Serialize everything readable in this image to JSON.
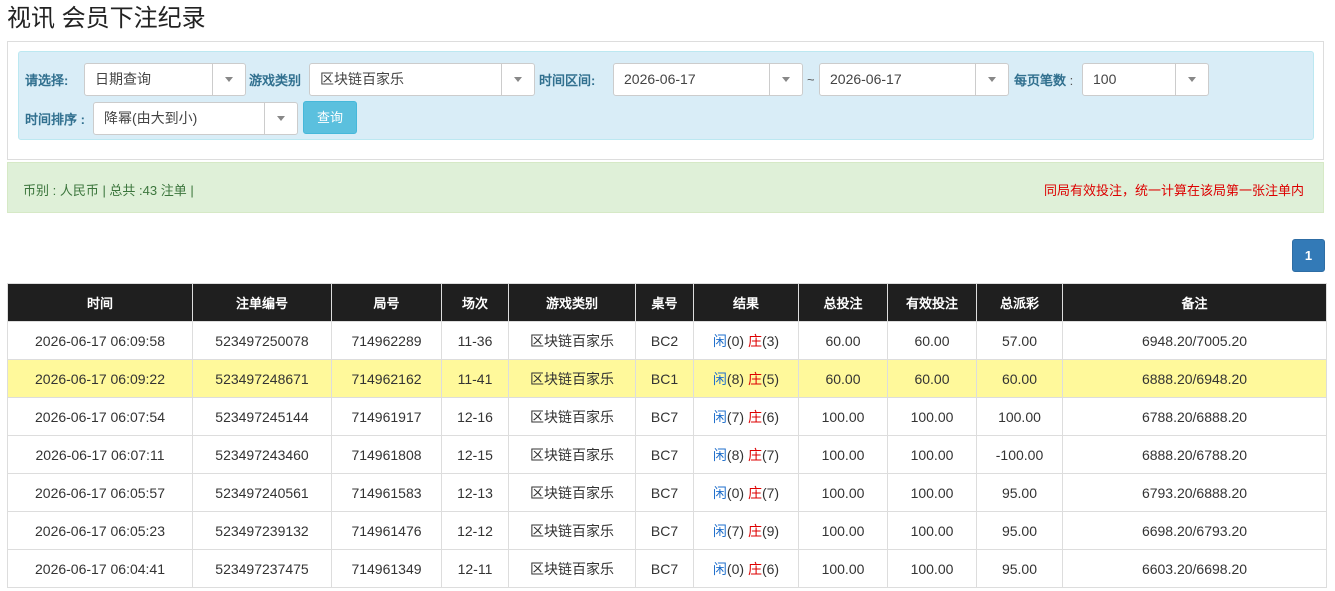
{
  "page_title": "视讯 会员下注纪录",
  "filters": {
    "select_label": "请选择:",
    "select_value": "日期查询",
    "game_label": "游戏类别",
    "game_value": "区块链百家乐",
    "range_label": "时间区间:",
    "date_from": "2026-06-17",
    "tilde": "~",
    "date_to": "2026-06-17",
    "per_page_label": "每页笔数",
    "per_page_sep": ":",
    "per_page_value": "100",
    "sort_label": "时间排序 :",
    "sort_value": "降幂(由大到小)",
    "query_button": "查询"
  },
  "info": {
    "summary": "币别 : 人民币 | 总共 :43 注单 |",
    "notice": "同局有效投注，统一计算在该局第一张注单内"
  },
  "pagination": {
    "current_page": "1"
  },
  "table": {
    "headers": [
      "时间",
      "注单编号",
      "局号",
      "场次",
      "游戏类别",
      "桌号",
      "结果",
      "总投注",
      "有效投注",
      "总派彩",
      "备注"
    ],
    "rows": [
      {
        "time": "2026-06-17 06:09:58",
        "bet_id": "523497250078",
        "round": "714962289",
        "session": "11-36",
        "game": "区块链百家乐",
        "table": "BC2",
        "player_label": "闲",
        "player_val": "(0)",
        "banker_label": "庄",
        "banker_val": "(3)",
        "total_bet": "60.00",
        "valid_bet": "60.00",
        "payout": "57.00",
        "note": "6948.20/7005.20"
      },
      {
        "time": "2026-06-17 06:09:22",
        "bet_id": "523497248671",
        "round": "714962162",
        "session": "11-41",
        "game": "区块链百家乐",
        "table": "BC1",
        "player_label": "闲",
        "player_val": "(8)",
        "banker_label": "庄",
        "banker_val": "(5)",
        "total_bet": "60.00",
        "valid_bet": "60.00",
        "payout": "60.00",
        "note": "6888.20/6948.20"
      },
      {
        "time": "2026-06-17 06:07:54",
        "bet_id": "523497245144",
        "round": "714961917",
        "session": "12-16",
        "game": "区块链百家乐",
        "table": "BC7",
        "player_label": "闲",
        "player_val": "(7)",
        "banker_label": "庄",
        "banker_val": "(6)",
        "total_bet": "100.00",
        "valid_bet": "100.00",
        "payout": "100.00",
        "note": "6788.20/6888.20"
      },
      {
        "time": "2026-06-17 06:07:11",
        "bet_id": "523497243460",
        "round": "714961808",
        "session": "12-15",
        "game": "区块链百家乐",
        "table": "BC7",
        "player_label": "闲",
        "player_val": "(8)",
        "banker_label": "庄",
        "banker_val": "(7)",
        "total_bet": "100.00",
        "valid_bet": "100.00",
        "payout": "-100.00",
        "note": "6888.20/6788.20"
      },
      {
        "time": "2026-06-17 06:05:57",
        "bet_id": "523497240561",
        "round": "714961583",
        "session": "12-13",
        "game": "区块链百家乐",
        "table": "BC7",
        "player_label": "闲",
        "player_val": "(0)",
        "banker_label": "庄",
        "banker_val": "(7)",
        "total_bet": "100.00",
        "valid_bet": "100.00",
        "payout": "95.00",
        "note": "6793.20/6888.20"
      },
      {
        "time": "2026-06-17 06:05:23",
        "bet_id": "523497239132",
        "round": "714961476",
        "session": "12-12",
        "game": "区块链百家乐",
        "table": "BC7",
        "player_label": "闲",
        "player_val": "(7)",
        "banker_label": "庄",
        "banker_val": "(9)",
        "total_bet": "100.00",
        "valid_bet": "100.00",
        "payout": "95.00",
        "note": "6698.20/6793.20"
      },
      {
        "time": "2026-06-17 06:04:41",
        "bet_id": "523497237475",
        "round": "714961349",
        "session": "12-11",
        "game": "区块链百家乐",
        "table": "BC7",
        "player_label": "闲",
        "player_val": "(0)",
        "banker_label": "庄",
        "banker_val": "(6)",
        "total_bet": "100.00",
        "valid_bet": "100.00",
        "payout": "95.00",
        "note": "6603.20/6698.20"
      }
    ]
  },
  "colors": {
    "header_bg": "#1f1f1f",
    "highlight_row": "#fff99b",
    "player": "#1f6fcc",
    "banker": "#dd0000",
    "negative": "#e00000"
  }
}
